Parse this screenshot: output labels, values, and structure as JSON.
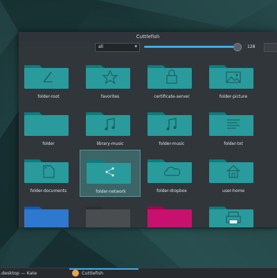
{
  "window": {
    "title": "Cuttlefish"
  },
  "toolbar": {
    "left_label": "",
    "filter_value": "all",
    "icon_size": "128",
    "icon_size_fraction": 0.96
  },
  "icons": [
    {
      "name": "folder-root",
      "label": "folder-root",
      "glyph": "slash",
      "color": "#2a9b9c"
    },
    {
      "name": "favorites",
      "label": "favorites",
      "glyph": "star",
      "color": "#2a9b9c"
    },
    {
      "name": "certificate-server",
      "label": "certificate-server",
      "glyph": "lock",
      "color": "#2a9b9c"
    },
    {
      "name": "folder-picture",
      "label": "folder-picture",
      "glyph": "picture",
      "color": "#2a9b9c"
    },
    {
      "name": "folder",
      "label": "folder",
      "glyph": "none",
      "color": "#2a9b9c"
    },
    {
      "name": "library-music",
      "label": "library-music",
      "glyph": "music",
      "color": "#2a9b9c"
    },
    {
      "name": "folder-music",
      "label": "folder-music",
      "glyph": "music",
      "color": "#2a9b9c"
    },
    {
      "name": "folder-txt",
      "label": "folder-txt",
      "glyph": "text",
      "color": "#2a9b9c"
    },
    {
      "name": "folder-documents",
      "label": "folder-documents",
      "glyph": "document",
      "color": "#2a9b9c"
    },
    {
      "name": "folder-network",
      "label": "folder-network",
      "glyph": "network",
      "color": "#2a9b9c"
    },
    {
      "name": "folder-dropbox",
      "label": "folder-dropbox",
      "glyph": "cloud",
      "color": "#2a9b9c"
    },
    {
      "name": "user-home",
      "label": "user-home",
      "glyph": "home",
      "color": "#2a9b9c"
    },
    {
      "name": "folder-blue",
      "label": "",
      "glyph": "none",
      "color": "#2f78d0"
    },
    {
      "name": "folder-dark",
      "label": "",
      "glyph": "none",
      "color": "#4a4d50"
    },
    {
      "name": "folder-magenta",
      "label": "",
      "glyph": "none",
      "color": "#c8106e"
    },
    {
      "name": "folder-print",
      "label": "",
      "glyph": "printer",
      "color": "#2a9b9c"
    }
  ],
  "selected_icon": "folder-network",
  "taskbar": {
    "task1": ".desktop — Kate",
    "task2": "Cuttlefish"
  }
}
